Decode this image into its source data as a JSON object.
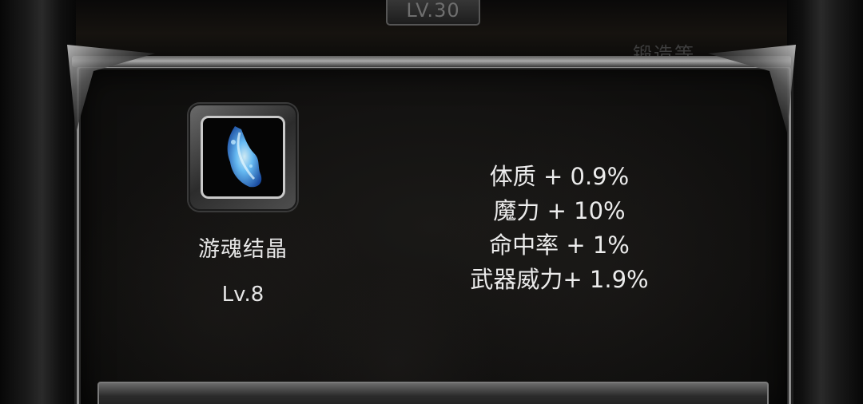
{
  "header": {
    "level_badge": "LV.30",
    "faded_tab_label": "锻造等"
  },
  "item": {
    "icon": "blue-soul-crystal-icon",
    "name": "游魂结晶",
    "level": "Lv.8"
  },
  "stats": [
    "体质 + 0.9%",
    "魔力 + 10%",
    "命中率 + 1%",
    "武器威力+ 1.9%"
  ],
  "colors": {
    "panel_border": "#8d8d8d",
    "text": "#e6e6e6",
    "crystal": "#4aa3ff"
  }
}
